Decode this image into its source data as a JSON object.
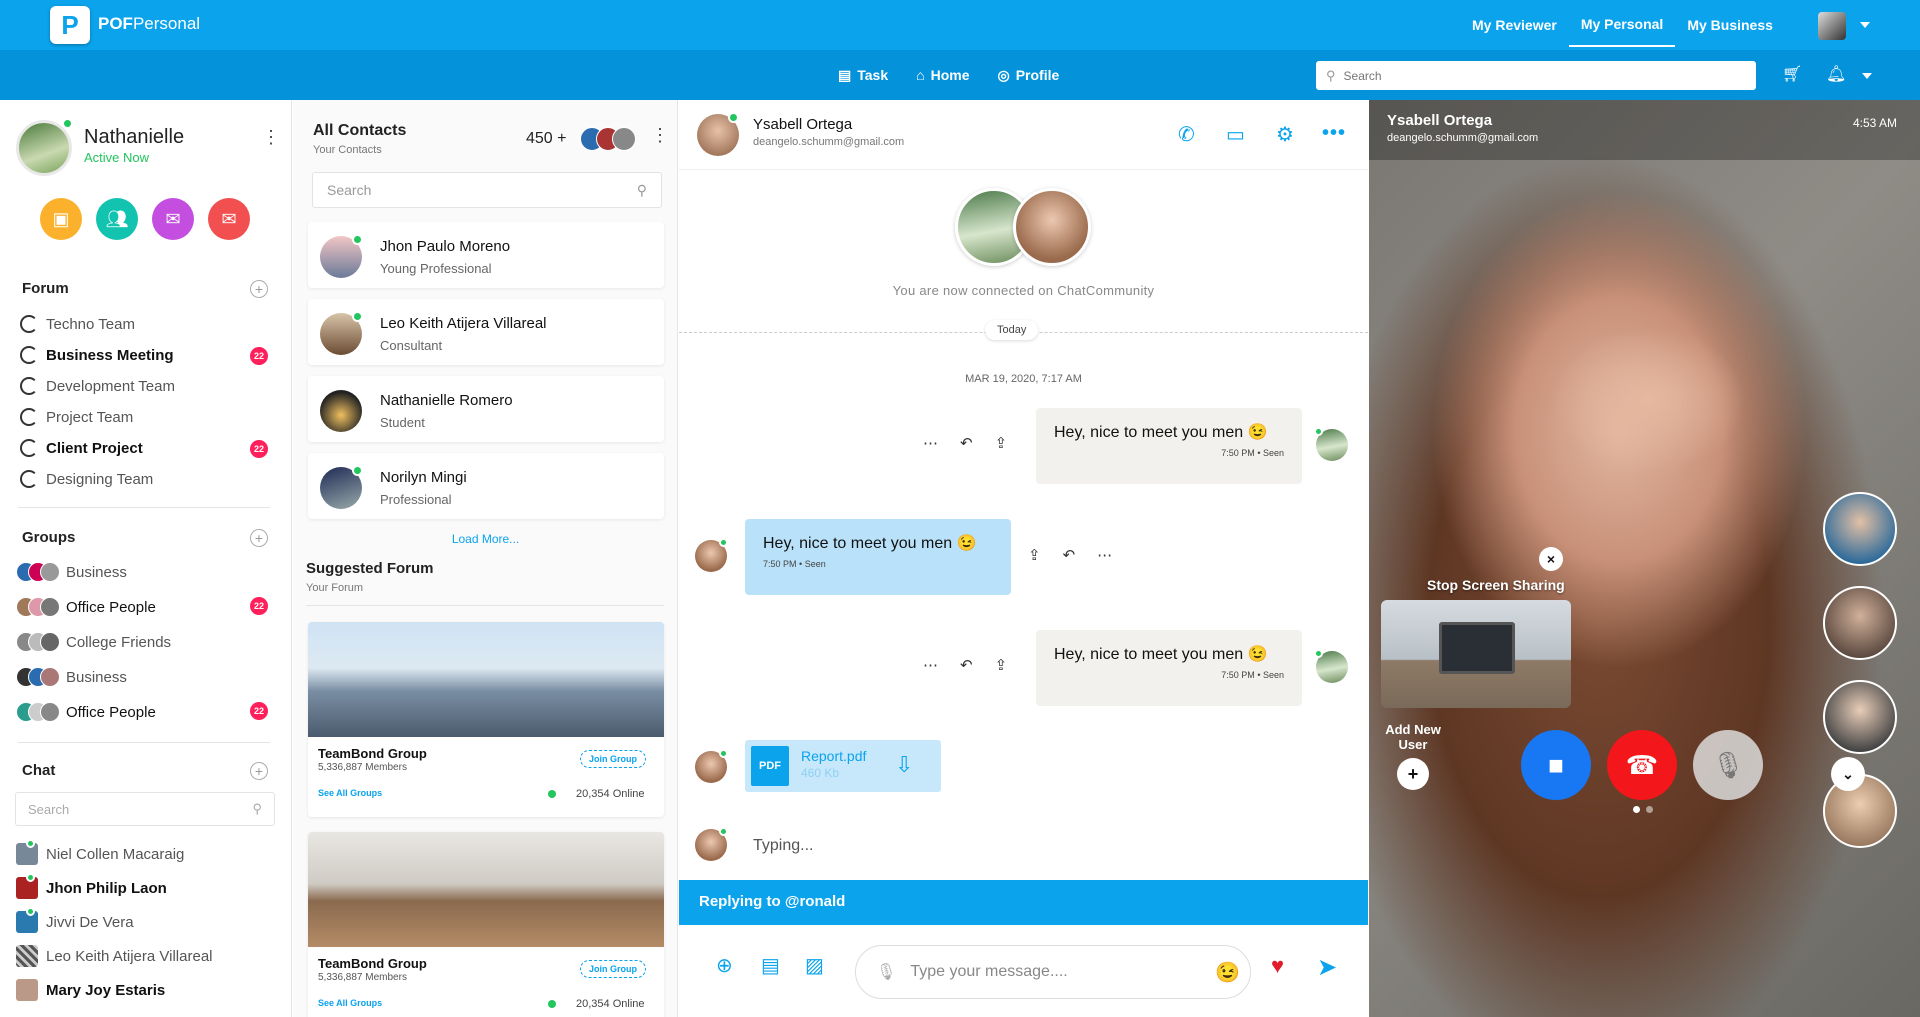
{
  "app": {
    "logo_letter": "P",
    "brand_bold": "POF",
    "brand_rest": "Personal"
  },
  "topnav": {
    "items": [
      "My Reviewer",
      "My Personal",
      "My Business"
    ],
    "active": "My Personal"
  },
  "subnav": {
    "task": "Task",
    "home": "Home",
    "profile": "Profile"
  },
  "search": {
    "placeholder": "Search"
  },
  "profile": {
    "name": "Nathanielle",
    "status": "Active Now"
  },
  "forum": {
    "title": "Forum",
    "items": [
      {
        "label": "Techno Team",
        "bold": false,
        "badge": ""
      },
      {
        "label": "Business Meeting",
        "bold": true,
        "badge": "22"
      },
      {
        "label": "Development Team",
        "bold": false,
        "badge": ""
      },
      {
        "label": "Project Team",
        "bold": false,
        "badge": ""
      },
      {
        "label": "Client Project",
        "bold": true,
        "badge": "22"
      },
      {
        "label": "Designing Team",
        "bold": false,
        "badge": ""
      }
    ]
  },
  "groups": {
    "title": "Groups",
    "items": [
      {
        "label": "Business",
        "badge": ""
      },
      {
        "label": "Office People",
        "badge": "22"
      },
      {
        "label": "College Friends",
        "badge": ""
      },
      {
        "label": "Business",
        "badge": ""
      },
      {
        "label": "Office People",
        "badge": "22"
      }
    ]
  },
  "chat": {
    "title": "Chat",
    "search_placeholder": "Search",
    "items": [
      "Niel Collen Macaraig",
      "Jhon Philip Laon",
      "Jivvi De Vera",
      "Leo Keith Atijera Villareal",
      "Mary Joy Estaris"
    ]
  },
  "contacts": {
    "title": "All Contacts",
    "subtitle": "Your Contacts",
    "count": "450 +",
    "search_placeholder": "Search",
    "items": [
      {
        "name": "Jhon Paulo Moreno",
        "role": "Young Professional"
      },
      {
        "name": "Leo Keith Atijera Villareal",
        "role": "Consultant"
      },
      {
        "name": "Nathanielle Romero",
        "role": "Student"
      },
      {
        "name": "Norilyn Mingi",
        "role": "Professional"
      }
    ],
    "load_more": "Load More..."
  },
  "suggested": {
    "title": "Suggested Forum",
    "subtitle": "Your Forum",
    "cards": [
      {
        "name": "TeamBond Group",
        "members": "5,336,887 Members",
        "join": "Join Group",
        "see_all": "See All Groups",
        "online": "20,354 Online"
      },
      {
        "name": "TeamBond Group",
        "members": "5,336,887 Members",
        "join": "Join Group",
        "see_all": "See All Groups",
        "online": "20,354 Online"
      }
    ]
  },
  "conversation": {
    "name": "Ysabell Ortega",
    "email": "deangelo.schumm@gmail.com",
    "connected": "You are now connected on ChatCommunity",
    "today": "Today",
    "date": "MAR 19, 2020, 7:17 AM",
    "messages": [
      {
        "text": "Hey, nice to meet you men 😉",
        "time": "7:50 PM",
        "status": "Seen"
      },
      {
        "text": "Hey, nice to meet you men 😉",
        "time": "7:50 PM",
        "status": "Seen"
      },
      {
        "text": "Hey, nice to meet you men 😉",
        "time": "7:50 PM",
        "status": "Seen"
      }
    ],
    "file": {
      "type": "PDF",
      "name": "Report.pdf",
      "size": "460 Kb"
    },
    "typing": "Typing...",
    "reply": "Replying to @ronald",
    "input_placeholder": "Type your message...."
  },
  "video": {
    "name": "Ysabell Ortega",
    "email": "deangelo.schumm@gmail.com",
    "time": "4:53 AM",
    "stop_sharing": "Stop Screen Sharing",
    "add_user": "Add New User"
  },
  "colors": {
    "primary": "#0aa3ec",
    "badge": "#ff1f5a",
    "online": "#22c55e",
    "end_call": "#f3161b",
    "video_call": "#1877f2"
  }
}
